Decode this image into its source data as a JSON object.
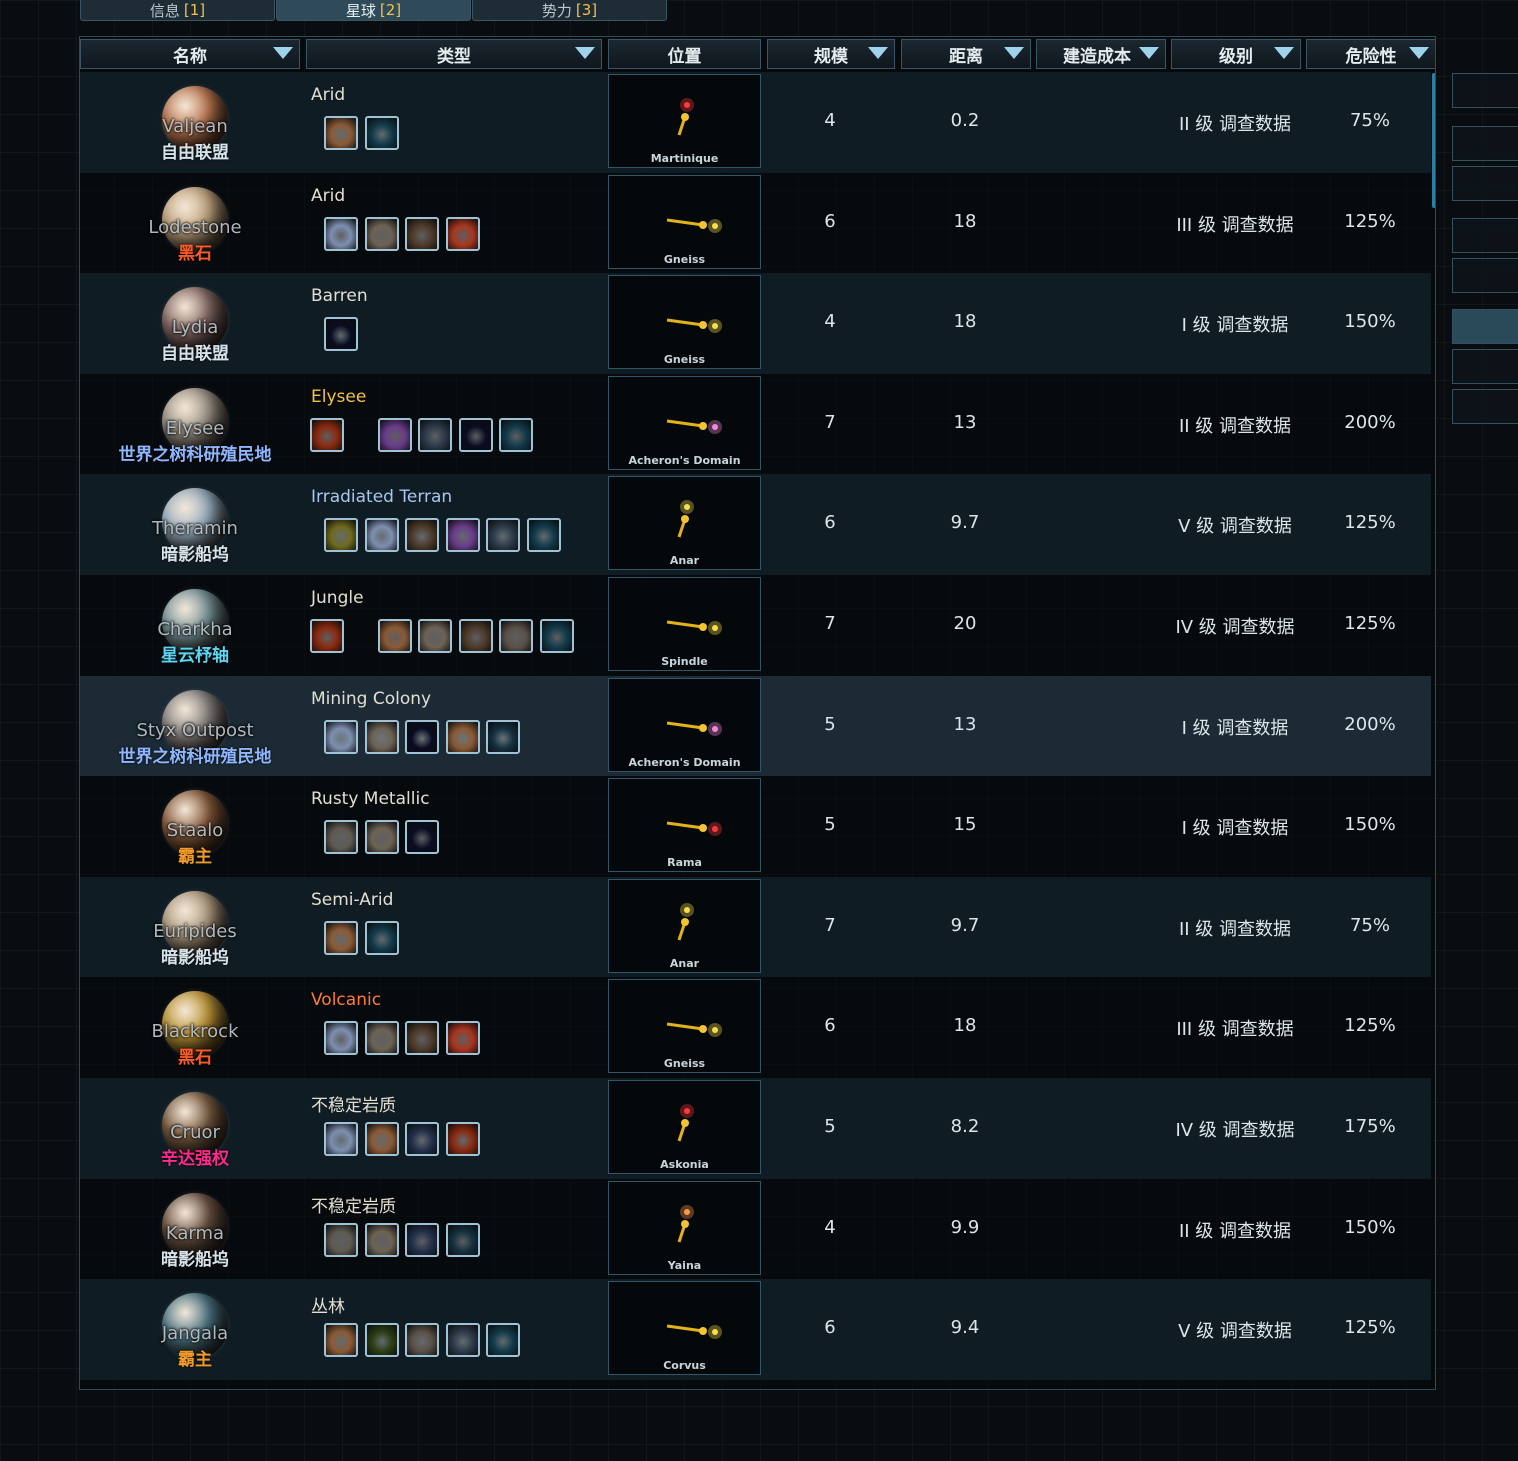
{
  "tabs": [
    {
      "label": "信息",
      "key": "1",
      "active": false
    },
    {
      "label": "星球",
      "key": "2",
      "active": true
    },
    {
      "label": "势力",
      "key": "3",
      "active": false
    }
  ],
  "headers": [
    {
      "label": "名称",
      "sort": true
    },
    {
      "label": "类型",
      "sort": true
    },
    {
      "label": "位置",
      "sort": false
    },
    {
      "label": "规模",
      "sort": true
    },
    {
      "label": "距离",
      "sort": true
    },
    {
      "label": "建造成本",
      "sort": true
    },
    {
      "label": "级别",
      "sort": true
    },
    {
      "label": "危险性",
      "sort": true
    }
  ],
  "icon_colors": {
    "desert": "#8a5a36",
    "ice": "#7d8fb0",
    "mountain": "#6d6255",
    "vine": "#4d3a2a",
    "heat": "#a8361f",
    "crystal": "#6a3c8a",
    "space": "#0c1740",
    "person": "#123a4a",
    "lava": "#8a2a10",
    "moss": "#6f6a1e",
    "wreck": "#2c3a4a",
    "sky": "#22304a",
    "rock": "#5a5048",
    "gas": "#153040",
    "plant": "#2b3e14",
    "metal": "#5e5a52",
    "stars": "#0a0d22",
    "roots": "#3a2a22"
  },
  "planets": [
    {
      "name": "Valjean",
      "faction": "自由联盟",
      "faction_color": "#d7e3ea",
      "type": "Arid",
      "type_color": "#e3ded2",
      "planet_color": "#c27a52",
      "icons": [
        "desert",
        "person"
      ],
      "system": "Martinique",
      "star_color": "#ff3a3a",
      "dir": "up",
      "scale": "4",
      "distance": "0.2",
      "tier": "II 级 调查数据",
      "risk": "75%"
    },
    {
      "name": "Lodestone",
      "faction": "黑石",
      "faction_color": "#ff5a2a",
      "type": "Arid",
      "type_color": "#e3ded2",
      "planet_color": "#c9ab84",
      "icons": [
        "ice",
        "mountain",
        "vine",
        "heat"
      ],
      "system": "Gneiss",
      "star_color": "#f5e04a",
      "dir": "right",
      "scale": "6",
      "distance": "18",
      "tier": "III 级 调查数据",
      "risk": "125%"
    },
    {
      "name": "Lydia",
      "faction": "自由联盟",
      "faction_color": "#d7e3ea",
      "type": "Barren",
      "type_color": "#e3ded2",
      "planet_color": "#8a6e69",
      "icons": [
        "stars"
      ],
      "system": "Gneiss",
      "star_color": "#f5e04a",
      "dir": "right",
      "scale": "4",
      "distance": "18",
      "tier": "I 级 调查数据",
      "risk": "150%"
    },
    {
      "name": "Elysee",
      "faction": "世界之树科研殖民地",
      "faction_color": "#8fb6ff",
      "type": "Elysee",
      "type_color": "#f2c14a",
      "planet_color": "#a59b8e",
      "icons": [
        "lava",
        "crystal",
        "wreck",
        "stars",
        "person"
      ],
      "system": "Acheron's Domain",
      "star_color": "#f08ad8",
      "dir": "right",
      "scale": "7",
      "distance": "13",
      "tier": "II 级 调查数据",
      "risk": "200%"
    },
    {
      "name": "Theramin",
      "faction": "暗影船坞",
      "faction_color": "#d7e3ea",
      "type": "Irradiated Terran",
      "type_color": "#a9c6ee",
      "planet_color": "#9fb6c8",
      "icons": [
        "moss",
        "ice",
        "vine",
        "crystal",
        "wreck",
        "person"
      ],
      "system": "Anar",
      "star_color": "#f5e04a",
      "dir": "up",
      "scale": "6",
      "distance": "9.7",
      "tier": "V 级 调查数据",
      "risk": "125%"
    },
    {
      "name": "Charkha",
      "faction": "星云杼轴",
      "faction_color": "#5ed6f2",
      "type": "Jungle",
      "type_color": "#e3ded2",
      "planet_color": "#7c9aa0",
      "icons": [
        "lava",
        "desert",
        "mountain",
        "vine",
        "rock",
        "person"
      ],
      "system": "Spindle",
      "star_color": "#f5e04a",
      "dir": "right",
      "scale": "7",
      "distance": "20",
      "tier": "IV 级 调查数据",
      "risk": "125%"
    },
    {
      "name": "Styx Outpost",
      "faction": "世界之树科研殖民地",
      "faction_color": "#8fb6ff",
      "type": "Mining Colony",
      "type_color": "#e3ded2",
      "planet_color": "#8d8885",
      "icons": [
        "ice",
        "mountain",
        "stars",
        "desert",
        "gas"
      ],
      "system": "Acheron's Domain",
      "star_color": "#f08ad8",
      "dir": "right",
      "scale": "5",
      "distance": "13",
      "tier": "I 级 调查数据",
      "risk": "200%"
    },
    {
      "name": "Staalo",
      "faction": "霸主",
      "faction_color": "#f29a2a",
      "type": "Rusty Metallic",
      "type_color": "#e3ded2",
      "planet_color": "#8c5e3e",
      "icons": [
        "metal",
        "mountain",
        "stars"
      ],
      "system": "Rama",
      "star_color": "#ff3a3a",
      "dir": "right",
      "scale": "5",
      "distance": "15",
      "tier": "I 级 调查数据",
      "risk": "150%"
    },
    {
      "name": "Euripides",
      "faction": "暗影船坞",
      "faction_color": "#d7e3ea",
      "type": "Semi-Arid",
      "type_color": "#e3ded2",
      "planet_color": "#b6a286",
      "icons": [
        "desert",
        "person"
      ],
      "system": "Anar",
      "star_color": "#f5e04a",
      "dir": "up",
      "scale": "7",
      "distance": "9.7",
      "tier": "II 级 调查数据",
      "risk": "75%"
    },
    {
      "name": "Blackrock",
      "faction": "黑石",
      "faction_color": "#ff5a2a",
      "type": "Volcanic",
      "type_color": "#ff7a3a",
      "planet_color": "#c49a36",
      "icons": [
        "ice",
        "mountain",
        "vine",
        "heat"
      ],
      "system": "Gneiss",
      "star_color": "#f5e04a",
      "dir": "right",
      "scale": "6",
      "distance": "18",
      "tier": "III 级 调查数据",
      "risk": "125%"
    },
    {
      "name": "Cruor",
      "faction": "辛达强权",
      "faction_color": "#ff2a8c",
      "type": "不稳定岩质",
      "type_color": "#e3ded2",
      "planet_color": "#7d5f44",
      "icons": [
        "ice",
        "desert",
        "sky",
        "lava"
      ],
      "system": "Askonia",
      "star_color": "#ff3a3a",
      "dir": "up",
      "scale": "5",
      "distance": "8.2",
      "tier": "IV 级 调查数据",
      "risk": "175%"
    },
    {
      "name": "Karma",
      "faction": "暗影船坞",
      "faction_color": "#d7e3ea",
      "type": "不稳定岩质",
      "type_color": "#e3ded2",
      "planet_color": "#6e5544",
      "icons": [
        "metal",
        "mountain",
        "sky",
        "gas"
      ],
      "system": "Yaina",
      "star_color": "#ff9a4a",
      "dir": "up",
      "scale": "4",
      "distance": "9.9",
      "tier": "II 级 调查数据",
      "risk": "150%"
    },
    {
      "name": "Jangala",
      "faction": "霸主",
      "faction_color": "#f29a2a",
      "type": "丛林",
      "type_color": "#e3ded2",
      "planet_color": "#4e7a8a",
      "icons": [
        "desert",
        "plant",
        "rock",
        "wreck",
        "person"
      ],
      "system": "Corvus",
      "star_color": "#f5e04a",
      "dir": "right",
      "scale": "6",
      "distance": "9.4",
      "tier": "V 级 调查数据",
      "risk": "125%"
    }
  ]
}
